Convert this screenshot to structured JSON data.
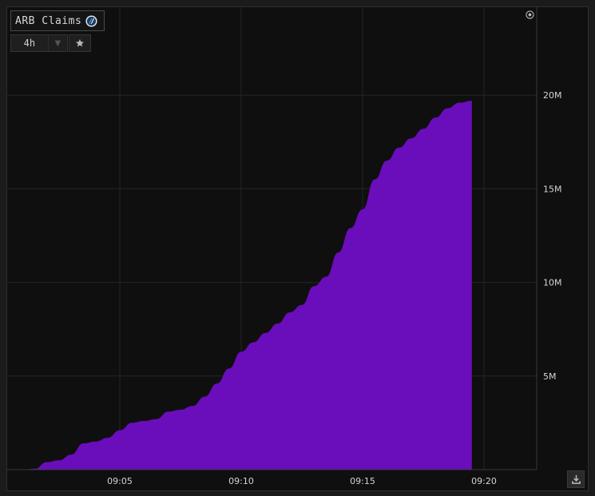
{
  "header": {
    "title": "ARB Claims",
    "logo_icon": "arbitrum-logo-icon"
  },
  "controls": {
    "timeframe": "4h",
    "dropdown_icon": "caret-down-icon",
    "favorite_icon": "star-icon",
    "settings_icon": "settings-icon",
    "download_icon": "download-icon"
  },
  "colors": {
    "area": "#6a0dbb",
    "background": "#0f0f0f",
    "grid": "#262626",
    "text": "#d4d4d4"
  },
  "chart_data": {
    "type": "area",
    "title": "ARB Claims",
    "xlabel": "",
    "ylabel": "",
    "x_tick_labels": [
      "09:05",
      "09:10",
      "09:15",
      "09:20"
    ],
    "y_tick_labels": [
      "5M",
      "10M",
      "15M",
      "20M"
    ],
    "y_ticks": [
      5000000,
      10000000,
      15000000,
      20000000
    ],
    "ylim": [
      0,
      24700000
    ],
    "grid": true,
    "series": [
      {
        "name": "",
        "x": [
          "09:01",
          "09:01:30",
          "09:02",
          "09:02:30",
          "09:03",
          "09:03:30",
          "09:04",
          "09:04:30",
          "09:05",
          "09:05:30",
          "09:06",
          "09:06:30",
          "09:07",
          "09:07:30",
          "09:08",
          "09:08:30",
          "09:09",
          "09:09:30",
          "09:10",
          "09:10:30",
          "09:11",
          "09:11:30",
          "09:12",
          "09:12:30",
          "09:13",
          "09:13:30",
          "09:14",
          "09:14:30",
          "09:15",
          "09:15:30",
          "09:16",
          "09:16:30",
          "09:17",
          "09:17:30",
          "09:18",
          "09:18:30",
          "09:19",
          "09:19:30"
        ],
        "values": [
          0,
          50000,
          400000,
          500000,
          800000,
          1400000,
          1500000,
          1700000,
          2100000,
          2500000,
          2600000,
          2700000,
          3100000,
          3200000,
          3400000,
          3900000,
          4600000,
          5400000,
          6300000,
          6800000,
          7300000,
          7800000,
          8400000,
          8800000,
          9800000,
          10300000,
          11600000,
          12900000,
          13900000,
          15500000,
          16500000,
          17200000,
          17700000,
          18200000,
          18800000,
          19300000,
          19600000,
          19700000
        ]
      }
    ]
  }
}
